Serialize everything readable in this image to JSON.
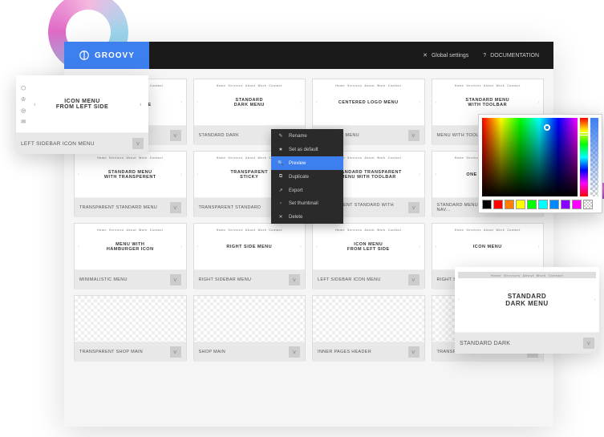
{
  "brand": "GROOVY",
  "header": {
    "global": "Global settings",
    "docs": "DOCUMENTATION"
  },
  "cards": [
    [
      {
        "title": "ICON MENU\nFROM LEFT SIDE",
        "label": "LEFT SIDEBAR ICON MENU"
      },
      {
        "title": "STANDARD\nDARK MENU",
        "label": "STANDARD DARK",
        "active": true
      },
      {
        "title": "CENTERED LOGO MENU",
        "label": "CENTERED MENU"
      },
      {
        "title": "STANDARD MENU\nWITH TOOLBAR",
        "label": "MENU WITH TOOLBAR"
      }
    ],
    [
      {
        "title": "STANDARD MENU\nWITH TRANSPERENT",
        "label": "TRANSPARENT STANDARD MENU"
      },
      {
        "title": "TRANSPARENT\nSTICKY",
        "label": "TRANSPARENT STANDARD"
      },
      {
        "title": "STANDARD TRANSPARENT\nMENU WITH TOOLBAR",
        "label": "TRANSPARENT STANDARD WITH TOOL..."
      },
      {
        "title": "ONE PAGE MENU",
        "label": "STANDARD MENU FOR ONEPAGE NAV..."
      }
    ],
    [
      {
        "title": "MENU WITH\nHAMBURGER ICON",
        "label": "MINIMALISTIC MENU"
      },
      {
        "title": "RIGHT SIDE MENU",
        "label": "RIGHT SIDEBAR MENU"
      },
      {
        "title": "ICON MENU\nFROM LEFT SIDE",
        "label": "LEFT SIDEBAR ICON MENU"
      },
      {
        "title": "ICON MENU",
        "label": "RIGHT SIDEBAR"
      }
    ],
    [
      {
        "title": "",
        "label": "TRANSPARENT SHOP MAIN",
        "chk": true
      },
      {
        "title": "",
        "label": "SHOP MAIN",
        "chk": true
      },
      {
        "title": "",
        "label": "INNER PAGES HEADER",
        "chk": true
      },
      {
        "title": "",
        "label": "TRANSPARENT STANDARD DARK ME...",
        "chk": true
      }
    ]
  ],
  "context_menu": [
    {
      "icon": "✎",
      "label": "Rename"
    },
    {
      "icon": "★",
      "label": "Set as default"
    },
    {
      "icon": "🔍",
      "label": "Preview",
      "active": true
    },
    {
      "icon": "⧉",
      "label": "Duplicate"
    },
    {
      "icon": "↗",
      "label": "Export"
    },
    {
      "icon": "▫",
      "label": "Set thumbnail"
    },
    {
      "icon": "✕",
      "label": "Delete"
    }
  ],
  "popup1": {
    "title": "ICON MENU\nFROM LEFT SIDE",
    "label": "LEFT SIDEBAR ICON MENU"
  },
  "popup2": {
    "title": "STANDARD\nDARK MENU",
    "label": "STANDARD DARK"
  },
  "nav_sample": [
    "Home",
    "Services",
    "About",
    "Work",
    "Contact"
  ],
  "swatches": [
    "#000",
    "#f00",
    "#ff8000",
    "#ff0",
    "#0f0",
    "#0ff",
    "#08f",
    "#80f",
    "#f0f"
  ]
}
